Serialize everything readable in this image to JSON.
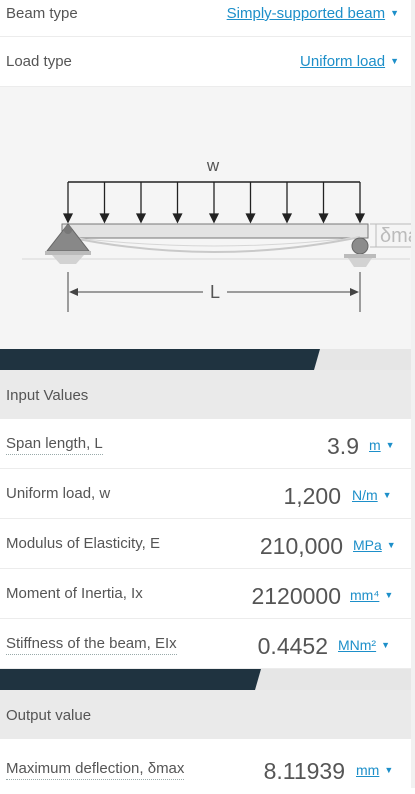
{
  "beam_type": {
    "label": "Beam type",
    "value": "Simply-supported beam"
  },
  "load_type": {
    "label": "Load type",
    "value": "Uniform load"
  },
  "diagram": {
    "load_label": "w",
    "span_label": "L",
    "deflection_label": "δma"
  },
  "input_section": {
    "title": "Input Values"
  },
  "inputs": [
    {
      "label": "Span length, L",
      "value": "3.9",
      "unit": "m"
    },
    {
      "label": "Uniform load, w",
      "value": "1,200",
      "unit": "N/m"
    },
    {
      "label": "Modulus of Elasticity, E",
      "value": "210,000",
      "unit": "MPa"
    },
    {
      "label": "Moment of Inertia, Ix",
      "value": "2120000",
      "unit": "mm⁴"
    },
    {
      "label": "Stiffness of the beam, EIx",
      "value": "0.4452",
      "unit": "MNm²"
    }
  ],
  "output_section": {
    "title": "Output value"
  },
  "outputs": [
    {
      "label": "Maximum deflection, δmax",
      "value": "8.11939",
      "unit": "mm"
    }
  ],
  "colors": {
    "link": "#1d8fc9",
    "dark_band": "#1f3340",
    "panel": "#f5f5f5"
  }
}
